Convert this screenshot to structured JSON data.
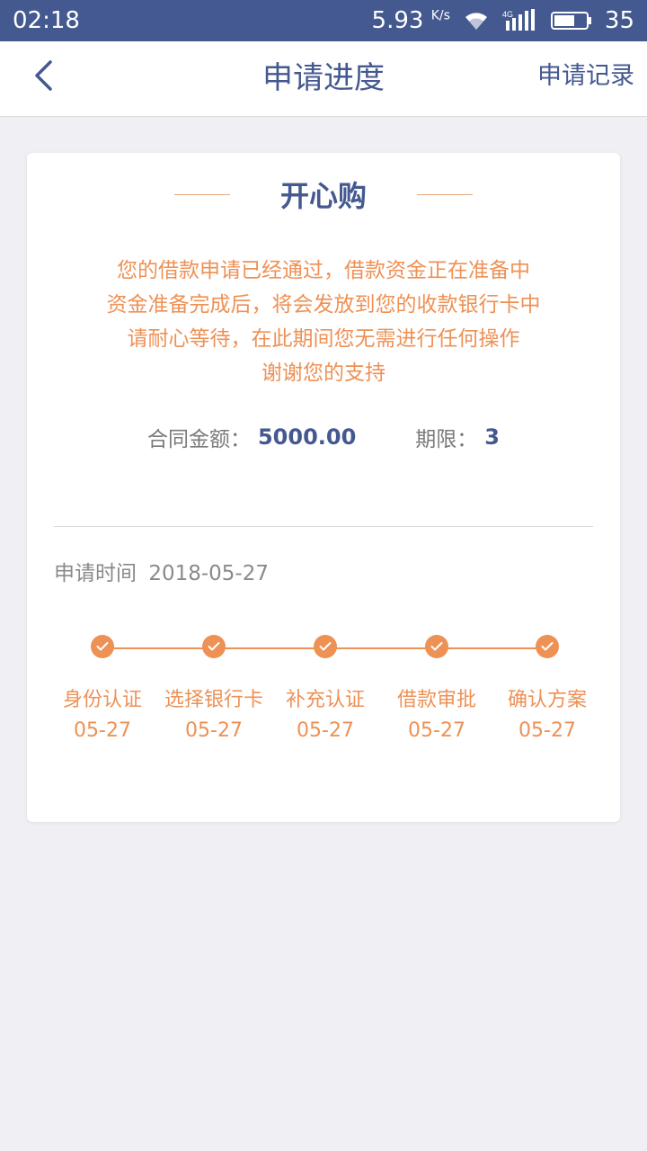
{
  "status_bar": {
    "time": "02:18",
    "speed": "5.93",
    "speed_unit": "K/s",
    "network": "4G",
    "battery": "35"
  },
  "nav": {
    "title": "申请进度",
    "action": "申请记录"
  },
  "card": {
    "title": "开心购",
    "message_lines": [
      "您的借款申请已经通过，借款资金正在准备中",
      "资金准备完成后，将会发放到您的收款银行卡中",
      "请耐心等待，在此期间您无需进行任何操作",
      "谢谢您的支持"
    ],
    "contract_amount_label": "合同金额：",
    "contract_amount": "5000.00",
    "term_label": "期限：",
    "term": "3",
    "apply_time_label": "申请时间",
    "apply_time": "2018-05-27",
    "steps": [
      {
        "label": "身份认证",
        "date": "05-27"
      },
      {
        "label": "选择银行卡",
        "date": "05-27"
      },
      {
        "label": "补充认证",
        "date": "05-27"
      },
      {
        "label": "借款审批",
        "date": "05-27"
      },
      {
        "label": "确认方案",
        "date": "05-27"
      }
    ]
  },
  "colors": {
    "primary": "#44598f",
    "accent": "#ee9155",
    "background": "#efeff4"
  },
  "icons": {
    "back": "chevron-left-icon",
    "step_done": "check-icon"
  }
}
